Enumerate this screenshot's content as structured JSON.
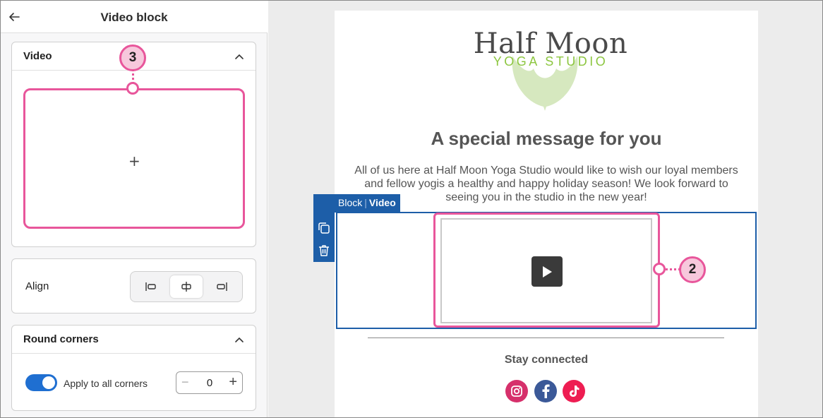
{
  "panel": {
    "title": "Video block",
    "video_section": {
      "title": "Video",
      "upload_symbol": "+"
    },
    "align_section": {
      "label": "Align",
      "options": [
        "align-left",
        "align-center",
        "align-right"
      ],
      "selected": "align-center"
    },
    "corners_section": {
      "title": "Round corners",
      "apply_all_label": "Apply to all corners",
      "apply_all_enabled": true,
      "radius_value": "0",
      "minus": "−",
      "plus": "+"
    }
  },
  "email": {
    "logo": {
      "line1": "Half Moon",
      "line2": "YOGA STUDIO"
    },
    "headline": "A special message for you",
    "body": "All of us here at Half Moon Yoga Studio would like to wish our loyal members and fellow yogis a healthy and happy holiday season! We look forward to seeing you in the studio in the new year!",
    "block_tab": {
      "parent": "Block",
      "separator": "|",
      "current": "Video"
    },
    "tools": [
      "move-icon",
      "duplicate-icon",
      "delete-icon"
    ],
    "footer": {
      "stay_connected": "Stay connected",
      "social": [
        "instagram-icon",
        "facebook-icon",
        "tiktok-icon"
      ]
    }
  },
  "callouts": {
    "video_preview": "2",
    "video_upload": "3"
  },
  "colors": {
    "accent": "#1d5ea8",
    "callout": "#e8569b",
    "toggle": "#1f6fd1",
    "logo_green": "#8cc63f",
    "instagram": "#d6306b",
    "facebook": "#3b5998",
    "tiktok": "#ee1d52"
  }
}
